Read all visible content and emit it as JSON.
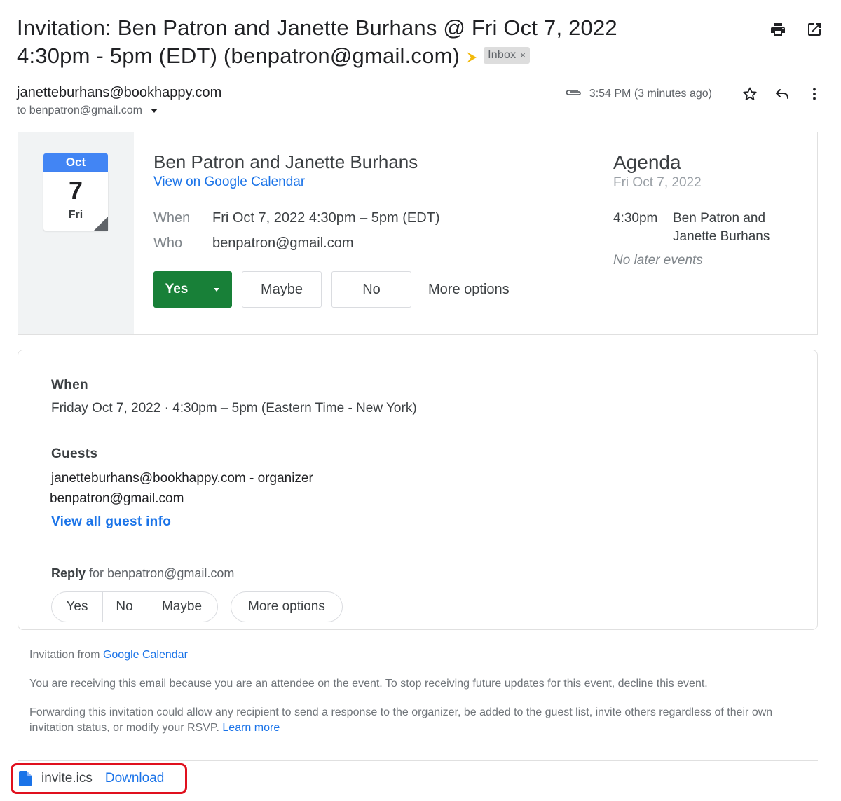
{
  "email": {
    "subject_line1": "Invitation: Ben Patron and Janette Burhans @ Fri Oct 7, 2022",
    "subject_line2": "4:30pm - 5pm (EDT) (benpatron@gmail.com)",
    "label": "Inbox",
    "label_remove": "×",
    "sender": "janetteburhans@bookhappy.com",
    "to": "to benpatron@gmail.com",
    "time": "3:54 PM (3 minutes ago)"
  },
  "icons": {
    "print": "print-icon",
    "open_new_window": "open-in-new-window-icon",
    "attachment": "paperclip-icon",
    "star": "star-icon",
    "reply": "reply-icon",
    "more": "more-vert-icon",
    "file": "file-icon"
  },
  "colors": {
    "yes_green": "#188038",
    "link_blue": "#1a73e8",
    "calendar_blue": "#4285f4",
    "importance_marker": "#f2b90b",
    "highlight_red": "#e0101e"
  },
  "calendar_icon": {
    "month": "Oct",
    "day": "7",
    "weekday": "Fri"
  },
  "event": {
    "title": "Ben Patron and Janette Burhans",
    "view_link": "View on Google Calendar",
    "when_label": "When",
    "when_value": "Fri Oct 7, 2022 4:30pm – 5pm (EDT)",
    "who_label": "Who",
    "who_value": "benpatron@gmail.com",
    "yes": "Yes",
    "maybe": "Maybe",
    "no": "No",
    "more_options": "More options"
  },
  "agenda": {
    "title": "Agenda",
    "date": "Fri Oct 7, 2022",
    "item_time": "4:30pm",
    "item_title": "Ben Patron and Janette Burhans",
    "no_later": "No later events"
  },
  "details": {
    "when_heading": "When",
    "when_text": "Friday Oct 7, 2022 · 4:30pm – 5pm (Eastern Time - New York)",
    "guests_heading": "Guests",
    "guests": [
      "janetteburhans@bookhappy.com - organizer",
      "benpatron@gmail.com"
    ],
    "view_all_guests": "View all guest info",
    "reply_bold": "Reply",
    "reply_for": " for benpatron@gmail.com",
    "reply_yes": "Yes",
    "reply_no": "No",
    "reply_maybe": "Maybe",
    "reply_more": "More options"
  },
  "footer": {
    "invitation_from": "Invitation from ",
    "google_calendar": "Google Calendar",
    "receiving": "You are receiving this email because you are an attendee on the event. To stop receiving future updates for this event, decline this event.",
    "forwarding": "Forwarding this invitation could allow any recipient to send a response to the organizer, be added to the guest list, invite others regardless of their own invitation status, or modify your RSVP. ",
    "learn_more": "Learn more"
  },
  "attachment": {
    "filename": "invite.ics",
    "download": "Download"
  }
}
